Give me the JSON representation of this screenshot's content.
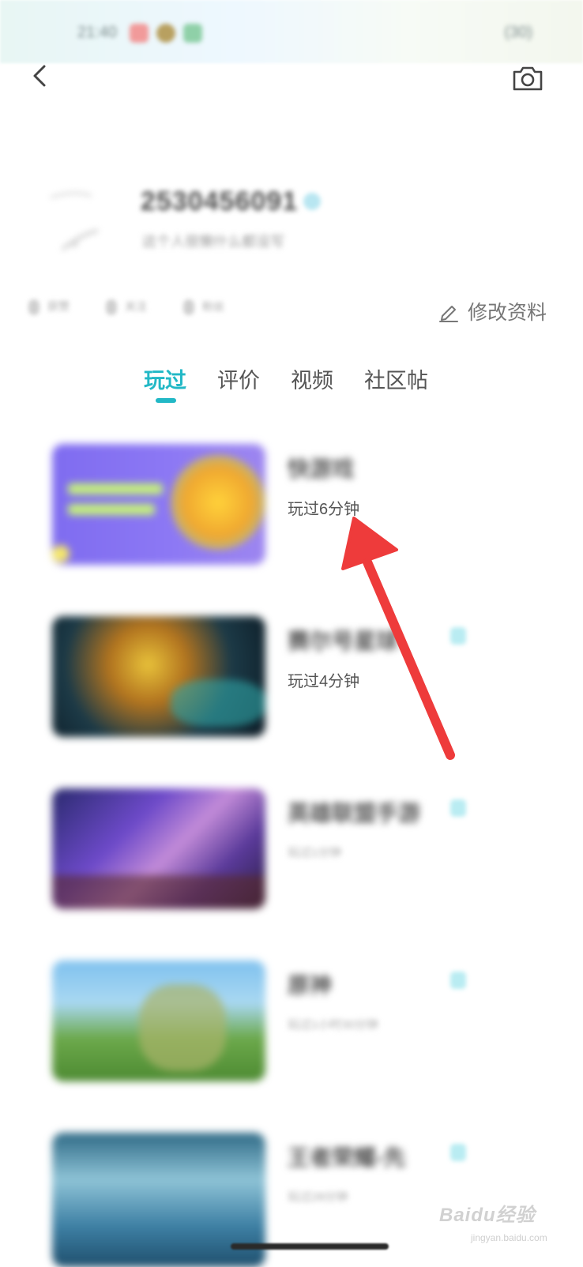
{
  "status_bar": {
    "time": "21:40",
    "battery": "(30)"
  },
  "header": {
    "back_icon": "chevron-left-icon",
    "camera_icon": "camera-icon"
  },
  "profile": {
    "user_id": "2530456091",
    "subtitle": "这个人很懒什么都没写",
    "stats": [
      "获赞",
      "关注",
      "粉丝"
    ],
    "edit_label": "修改资料",
    "edit_icon": "pencil-icon"
  },
  "tabs": [
    {
      "label": "玩过",
      "active": true
    },
    {
      "label": "评价",
      "active": false
    },
    {
      "label": "视频",
      "active": false
    },
    {
      "label": "社区帖",
      "active": false
    }
  ],
  "games": [
    {
      "title": "快游戏",
      "time": "玩过6分钟"
    },
    {
      "title": "赛尔号星球",
      "time": "玩过4分钟"
    },
    {
      "title": "英雄联盟手游",
      "time": "玩过1分钟"
    },
    {
      "title": "原神",
      "time": "玩过1小时30分钟"
    },
    {
      "title": "王者荣耀-先",
      "time": "玩过28分钟"
    }
  ],
  "watermark": {
    "text": "Baidu经验",
    "url": "jingyan.baidu.com"
  },
  "colors": {
    "accent": "#22b8c6",
    "arrow": "#ee3b3b"
  }
}
